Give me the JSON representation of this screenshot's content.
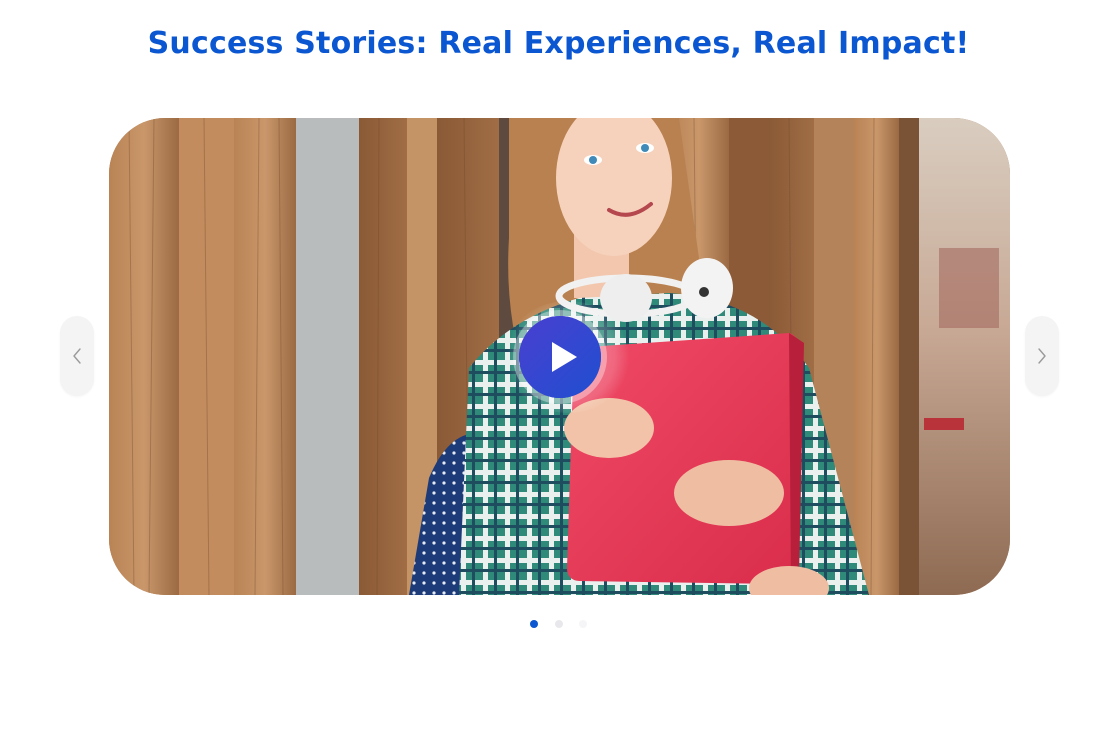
{
  "section": {
    "title": "Success Stories: Real Experiences, Real Impact!"
  },
  "colors": {
    "title": "#0b56d1",
    "play_button": "#3b43c9",
    "dot_active": "#0b56d1",
    "dot_inactive": "#e8e8ec",
    "arrow_icon": "#9a9a9a"
  },
  "carousel": {
    "active_slide": 1,
    "slide_count": 3,
    "slide_image": "student-holding-red-folder-photo",
    "play_icon": "play-icon",
    "prev_icon": "chevron-left-icon",
    "next_icon": "chevron-right-icon"
  }
}
